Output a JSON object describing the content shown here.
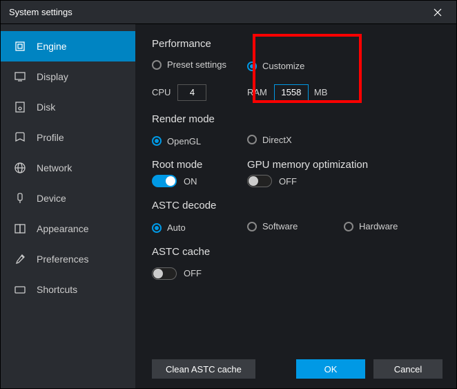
{
  "window": {
    "title": "System settings"
  },
  "sidebar": {
    "items": [
      {
        "label": "Engine"
      },
      {
        "label": "Display"
      },
      {
        "label": "Disk"
      },
      {
        "label": "Profile"
      },
      {
        "label": "Network"
      },
      {
        "label": "Device"
      },
      {
        "label": "Appearance"
      },
      {
        "label": "Preferences"
      },
      {
        "label": "Shortcuts"
      }
    ]
  },
  "performance": {
    "title": "Performance",
    "preset_label": "Preset settings",
    "customize_label": "Customize",
    "cpu_label": "CPU",
    "cpu_value": "4",
    "ram_label": "RAM",
    "ram_value": "1558",
    "ram_unit": "MB"
  },
  "render": {
    "title": "Render mode",
    "opengl_label": "OpenGL",
    "directx_label": "DirectX"
  },
  "root": {
    "title": "Root mode",
    "value": "ON"
  },
  "gpu": {
    "title": "GPU memory optimization",
    "value": "OFF"
  },
  "astc_decode": {
    "title": "ASTC decode",
    "auto_label": "Auto",
    "software_label": "Software",
    "hardware_label": "Hardware"
  },
  "astc_cache": {
    "title": "ASTC cache",
    "value": "OFF"
  },
  "footer": {
    "clean_label": "Clean ASTC cache",
    "ok_label": "OK",
    "cancel_label": "Cancel"
  }
}
